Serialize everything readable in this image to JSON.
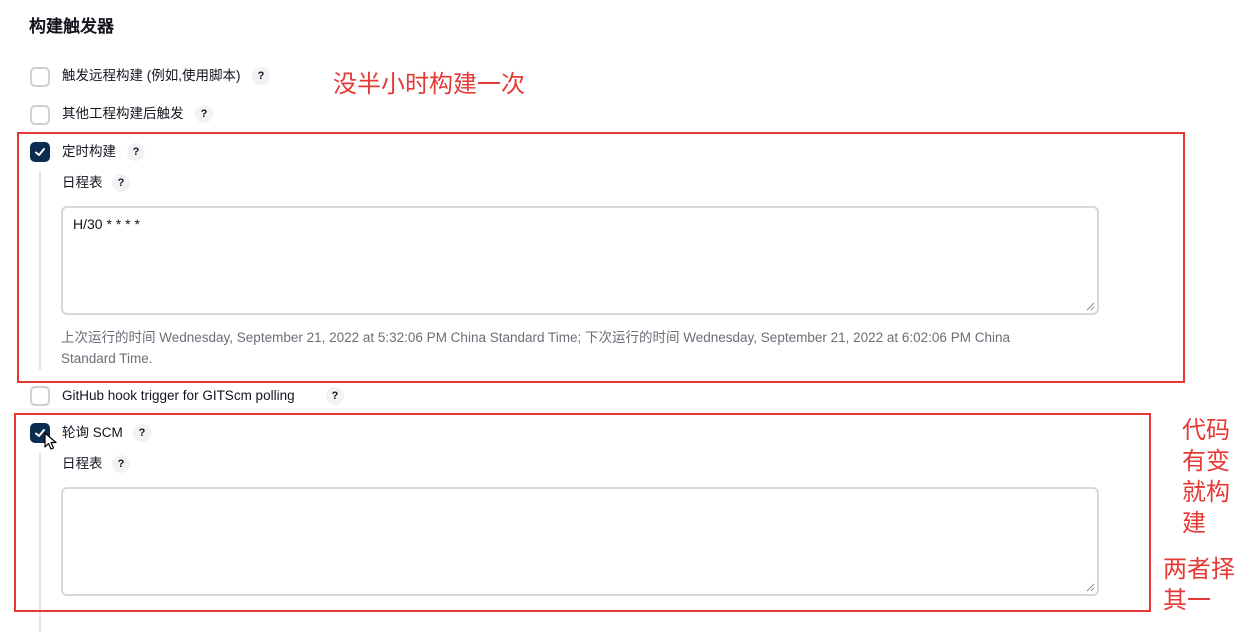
{
  "section": {
    "title": "构建触发器"
  },
  "triggers": [
    {
      "label": "触发远程构建 (例如,使用脚本)",
      "checked": false,
      "help": "?"
    },
    {
      "label": "其他工程构建后触发",
      "checked": false,
      "help": "?"
    },
    {
      "label": "定时构建",
      "checked": true,
      "help": "?"
    },
    {
      "label": "GitHub hook trigger for GITScm polling",
      "checked": false,
      "help": "?"
    },
    {
      "label": "轮询 SCM",
      "checked": true,
      "help": "?"
    }
  ],
  "timed_build": {
    "schedule_label": "日程表",
    "schedule_help": "?",
    "schedule_value": "H/30 * * * *",
    "hint_line1": "上次运行的时间 Wednesday, September 21, 2022 at 5:32:06 PM China Standard Time; 下次运行的时间 Wednesday, September 21, 2022 at 6:02:06 PM China",
    "hint_line2": "Standard Time."
  },
  "scm_polling": {
    "schedule_label": "日程表",
    "schedule_help": "?",
    "schedule_value": ""
  },
  "annotations": {
    "half_hour": "没半小时构建一次",
    "code_change": [
      "代码",
      "有变",
      "就构",
      "建"
    ],
    "choose_one": [
      "两者择",
      "其一"
    ]
  },
  "colors": {
    "accent": "#0b2d50",
    "annotation": "#e53935"
  }
}
